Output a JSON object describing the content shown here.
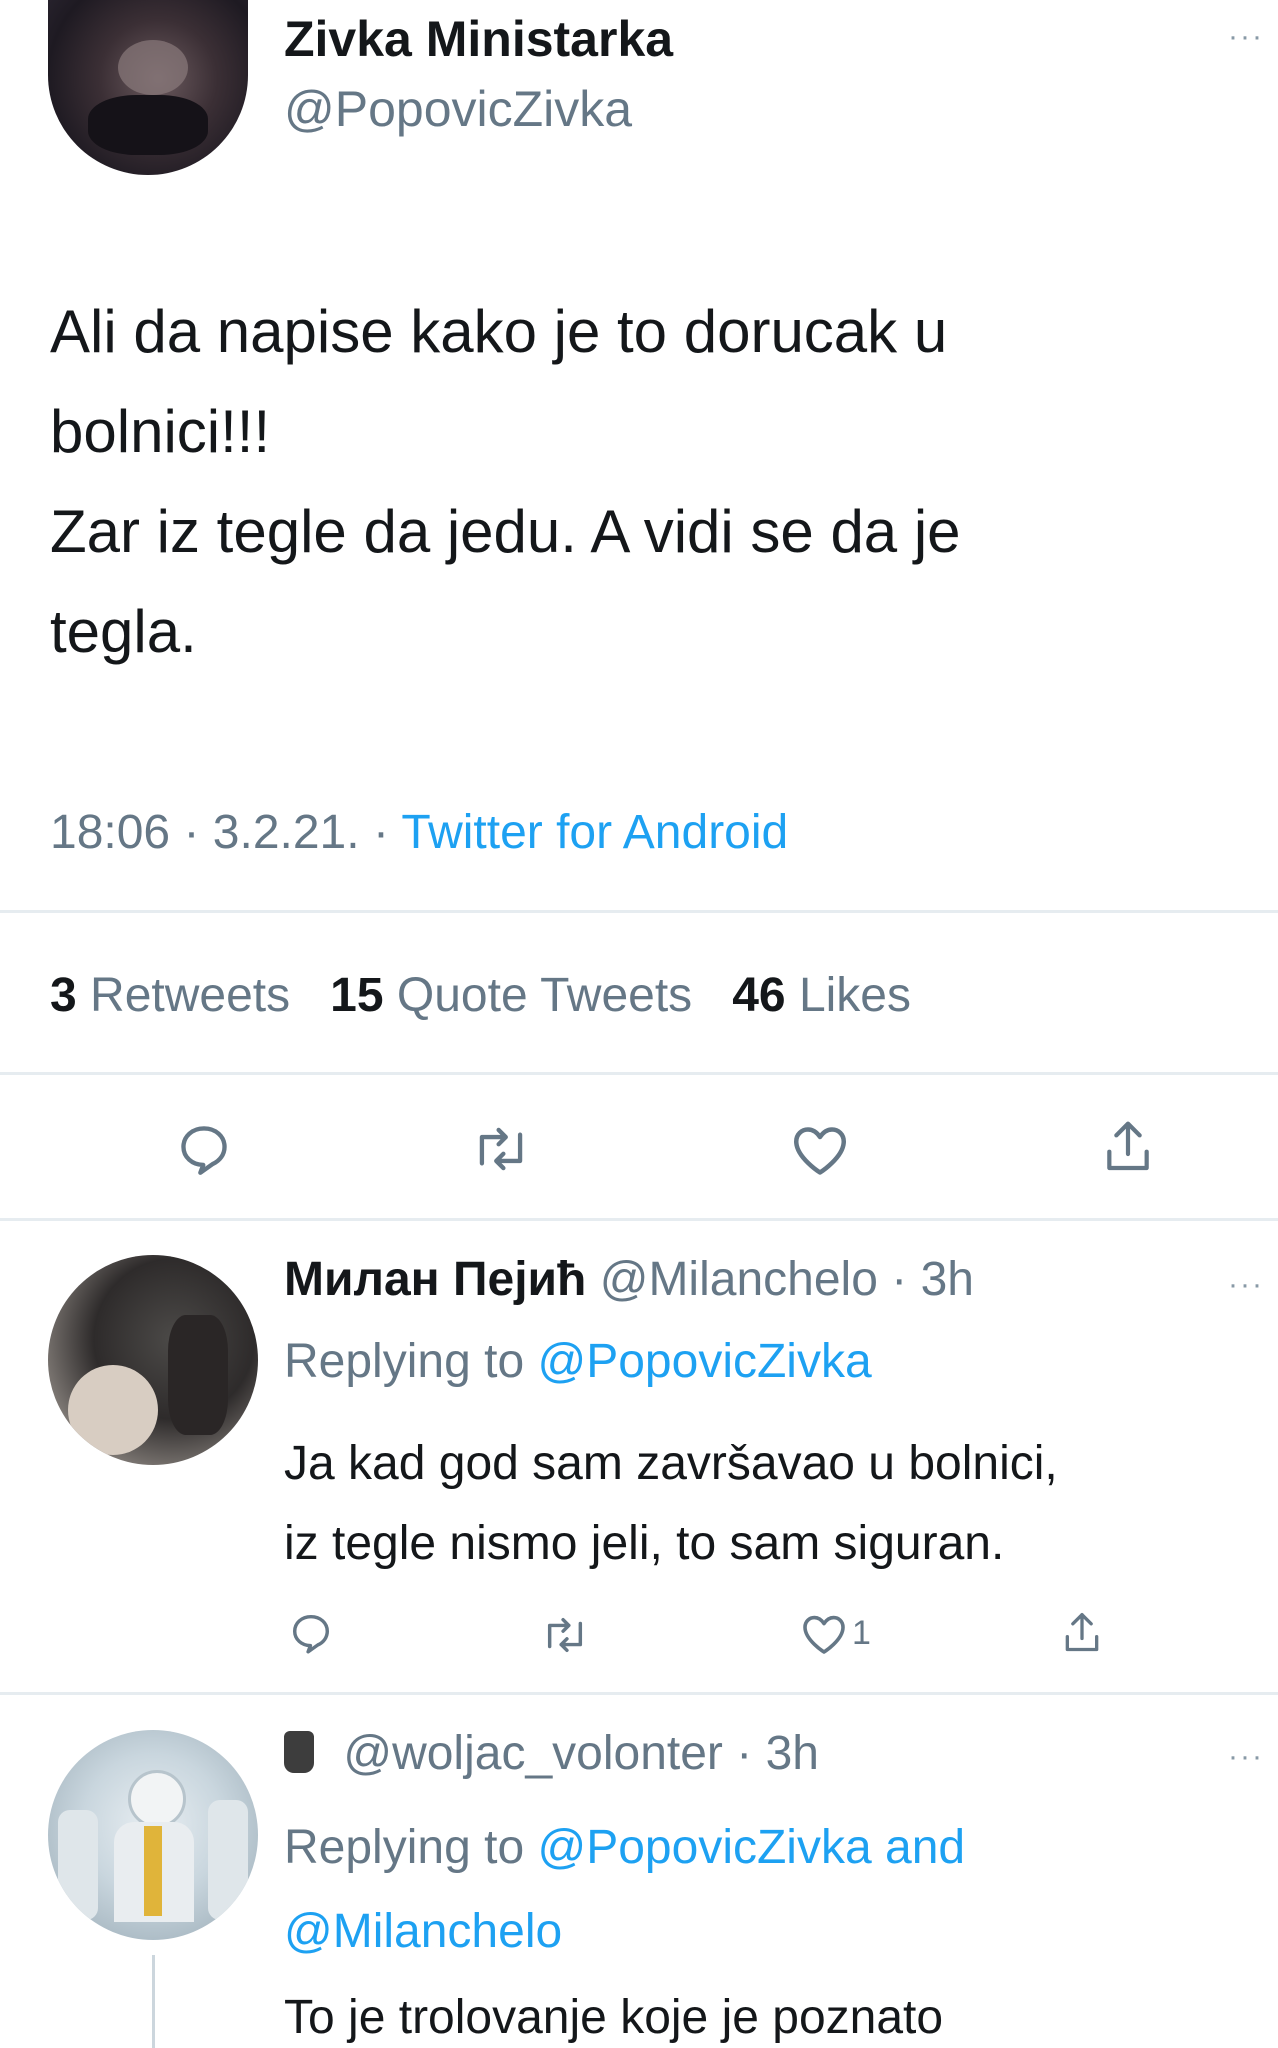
{
  "colors": {
    "link_blue": "#1da1f2",
    "secondary_gray": "#657786",
    "divider": "#e6ecf0",
    "text": "#14171a"
  },
  "main_tweet": {
    "display_name": "Zivka Ministarka",
    "handle": "@PopovicZivka",
    "text_lines": [
      "Ali da napise kako je to dorucak u",
      "bolnici!!!",
      "Zar iz tegle da jedu. A vidi se da je",
      "tegla."
    ],
    "time": "18:06",
    "date": "3.2.21.",
    "source": "Twitter for Android",
    "stats": {
      "retweets_count": "3",
      "retweets_label": "Retweets",
      "quotes_count": "15",
      "quotes_label": "Quote Tweets",
      "likes_count": "46",
      "likes_label": "Likes"
    },
    "actions": [
      "reply-icon",
      "retweet-icon",
      "like-icon",
      "share-icon"
    ]
  },
  "replies": [
    {
      "display_name": "Милан Пејић",
      "handle": "@Milanchelo",
      "time": "3h",
      "replying_prefix": "Replying to",
      "replying_to": "@PopovicZivka",
      "text_lines": [
        "Ja kad god sam završavao u bolnici,",
        "iz tegle nismo jeli, to sam siguran."
      ],
      "like_count": "1"
    },
    {
      "display_name": "",
      "handle": "@woljac_volonter",
      "time": "3h",
      "replying_prefix": "Replying to",
      "replying_to_line1": "@PopovicZivka and",
      "replying_to_line2": "@Milanchelo",
      "text_lines": [
        "To je trolovanje koje je poznato"
      ]
    }
  ]
}
